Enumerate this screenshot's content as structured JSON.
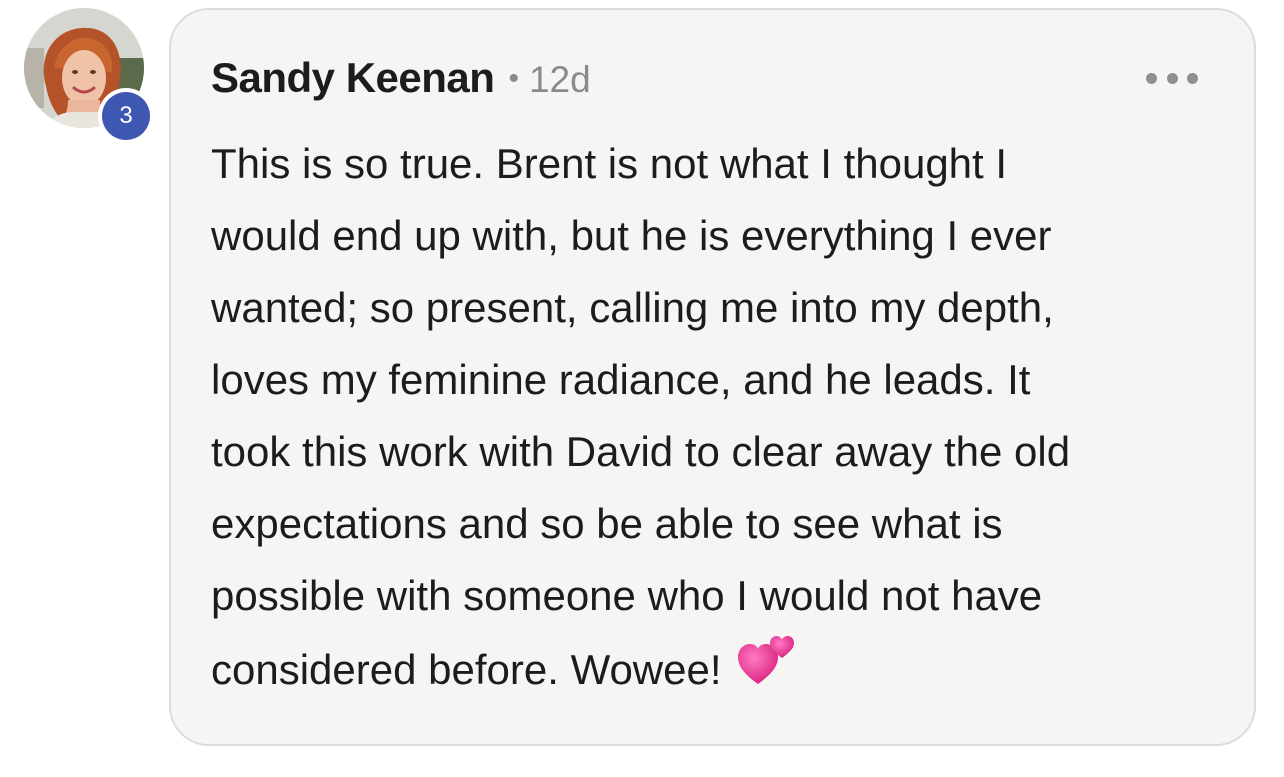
{
  "comment": {
    "author": "Sandy Keenan",
    "separator": "•",
    "timestamp": "12d",
    "level_badge": "3",
    "more_icon": "more-horizontal-icon",
    "body_lines": [
      "This is so true. Brent is not what I thought I",
      "would end up with, but he is everything I ever",
      "wanted; so present, calling me into my depth,",
      "loves my feminine radiance, and he leads. It",
      "took this work with David to clear away the old",
      "expectations and so be able to see what is",
      "possible with someone who I would not have",
      "considered before. Wowee!"
    ],
    "emoji": "two-hearts-icon"
  },
  "colors": {
    "bubble_bg": "#f6f5f4",
    "bubble_border": "#dcdcdc",
    "badge_bg": "#3e57b0",
    "text": "#1c1c1e",
    "muted": "#8a8a8e",
    "heart": "#e8358f"
  }
}
